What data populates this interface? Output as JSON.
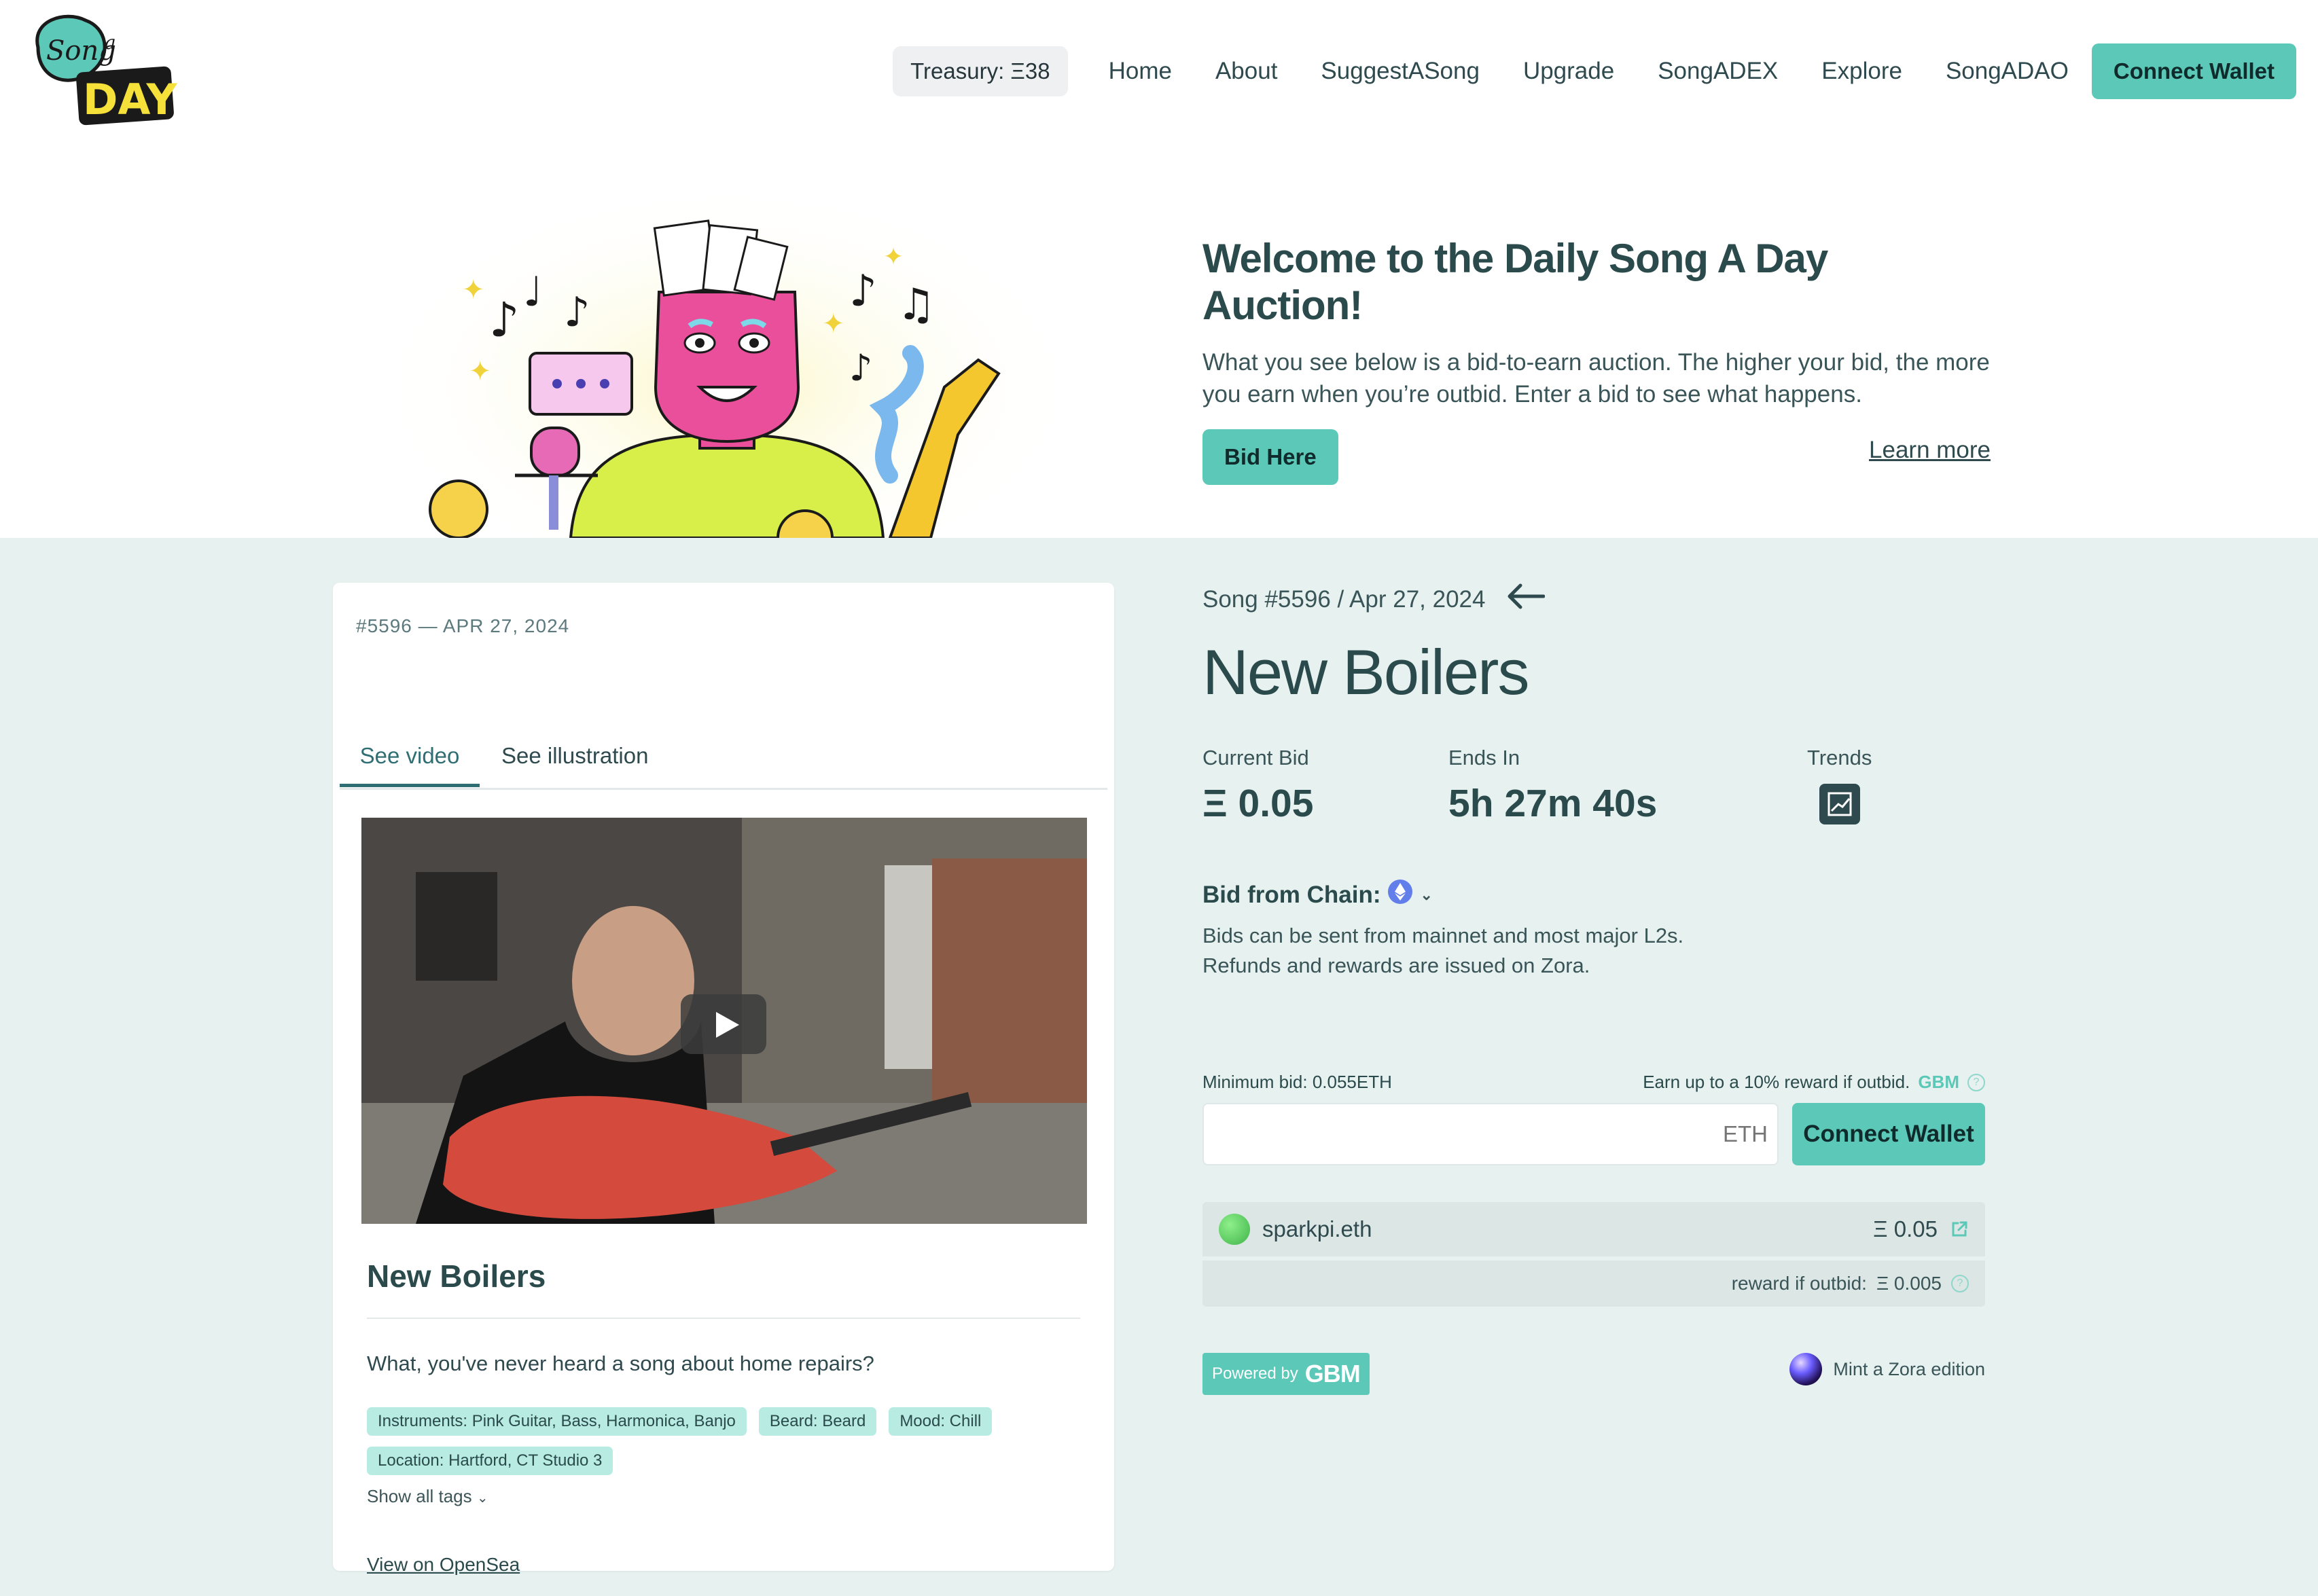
{
  "header": {
    "treasury": "Treasury: Ξ38",
    "nav": [
      "Home",
      "About",
      "SuggestASong",
      "Upgrade",
      "SongADEX",
      "Explore",
      "SongADAO"
    ],
    "connect_wallet": "Connect Wallet"
  },
  "hero": {
    "title": "Welcome to the Daily Song A Day Auction!",
    "description": "What you see below is a bid-to-earn auction. The higher your bid, the more you earn when you’re outbid. Enter a bid to see what happens.",
    "bid_here": "Bid Here",
    "learn_more": "Learn more"
  },
  "song_card": {
    "meta": "#5596 — APR 27, 2024",
    "tabs": [
      "See video",
      "See illustration"
    ],
    "title": "New Boilers",
    "description": "What, you've never heard a song about home repairs?",
    "tags": [
      "Instruments: Pink Guitar, Bass, Harmonica, Banjo",
      "Beard: Beard",
      "Mood: Chill",
      "Location: Hartford, CT Studio 3"
    ],
    "show_all_tags": "Show all tags",
    "view_opensea": "View on OpenSea"
  },
  "auction": {
    "song_line": "Song #5596 / Apr 27, 2024",
    "title": "New Boilers",
    "current_bid_label": "Current Bid",
    "current_bid_value": "Ξ 0.05",
    "ends_in_label": "Ends In",
    "ends_in_value": "5h 27m 40s",
    "trends_label": "Trends",
    "chain_label": "Bid from Chain:",
    "chain_desc_1": "Bids can be sent from mainnet and most major L2s.",
    "chain_desc_2": "Refunds and rewards are issued on Zora.",
    "min_bid": "Minimum bid: 0.055ETH",
    "earn_text": "Earn up to a 10% reward if outbid.",
    "earn_gbm": "GBM",
    "input_placeholder": "ETH",
    "connect_wallet": "Connect Wallet",
    "bidder_name": "sparkpi.eth",
    "bid_amount": "Ξ 0.05",
    "reward_label": "reward if outbid:",
    "reward_value": "Ξ 0.005",
    "powered_by": "Powered by",
    "powered_gbm": "GBM",
    "mint_zora": "Mint a Zora edition"
  },
  "logo": {
    "line1": "Song a",
    "line2": "DAY"
  },
  "colors": {
    "accent": "#5cc8b8",
    "background": "#e7f1ef",
    "text": "#2f4a4e"
  }
}
